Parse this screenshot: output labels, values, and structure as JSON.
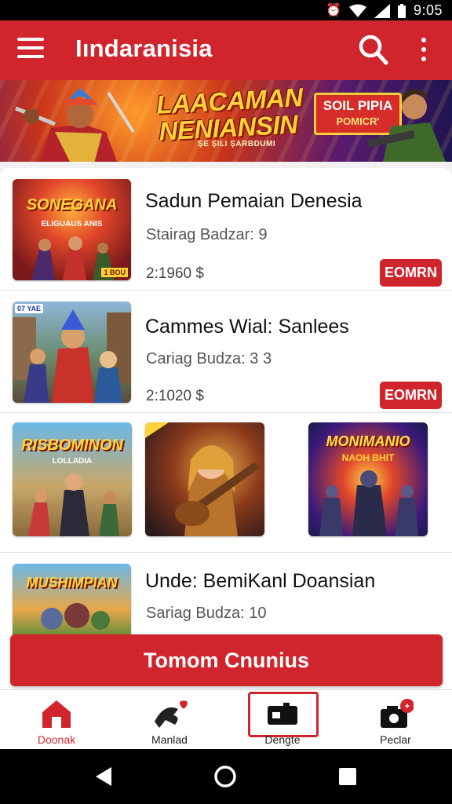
{
  "status_bar": {
    "time": "9:05"
  },
  "app_bar": {
    "title": "Iındaranisia"
  },
  "banner": {
    "headline_line1": "LAACAMAN",
    "headline_line2": "NENIANSIN",
    "tagline": "ŞE ŞILI ŞARBDUMI",
    "promo_line1": "SOIL PIPIA",
    "promo_line2": "POMICR'"
  },
  "items": [
    {
      "title": "Sadun Pemaian Denesia",
      "subtitle": "Stairag Badzar: 9",
      "price": "2:1960 $",
      "button": "EOMRN",
      "thumb_text": "SONEGANA",
      "thumb_sub": "ELIGUAUS ANIS",
      "thumb_badge": "1 BOU"
    },
    {
      "title": "Cammes Wial: Sanlees",
      "subtitle": "Cariag Budza: 3 3",
      "price": "2:1020 $",
      "button": "EOMRN",
      "thumb_badge": "07 YAE"
    },
    {
      "title": "Unde: BemiKanl Doansian",
      "subtitle": "Sariag Budza: 10",
      "thumb_text": "MUSHIMPIAN"
    }
  ],
  "tiles": [
    {
      "title": "RISBOMINON",
      "sub": "LOLLADIA"
    },
    {
      "title": ""
    },
    {
      "title": "MONIMANIO",
      "sub": "NAOH BHIT"
    }
  ],
  "cta": {
    "label": "Tomom Cnunius"
  },
  "bottom_nav": [
    {
      "label": "Doonak",
      "icon": "home-icon",
      "active": true
    },
    {
      "label": "Manlad",
      "icon": "bird-heart-icon",
      "active": false
    },
    {
      "label": "Dengte",
      "icon": "game-controller-icon",
      "active": false
    },
    {
      "label": "Peclar",
      "icon": "camera-badge-icon",
      "active": false
    }
  ],
  "colors": {
    "primary": "#d1252d",
    "banner_text": "#ffd23a"
  }
}
